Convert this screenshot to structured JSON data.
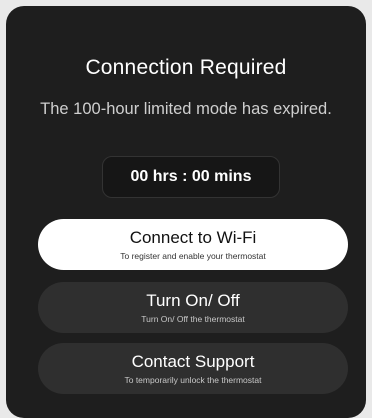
{
  "dialog": {
    "title": "Connection Required",
    "message": "The 100-hour limited mode has expired.",
    "timer": "00 hrs : 00 mins"
  },
  "buttons": {
    "wifi": {
      "label": "Connect to Wi-Fi",
      "sublabel": "To register and enable your thermostat"
    },
    "power": {
      "label": "Turn On/ Off",
      "sublabel": "Turn On/ Off the thermostat"
    },
    "support": {
      "label": "Contact Support",
      "sublabel": "To temporarily unlock the thermostat"
    }
  },
  "colors": {
    "modal_background": "#1e1e1e",
    "primary_button": "#ffffff",
    "secondary_button": "#2f2f2f"
  }
}
